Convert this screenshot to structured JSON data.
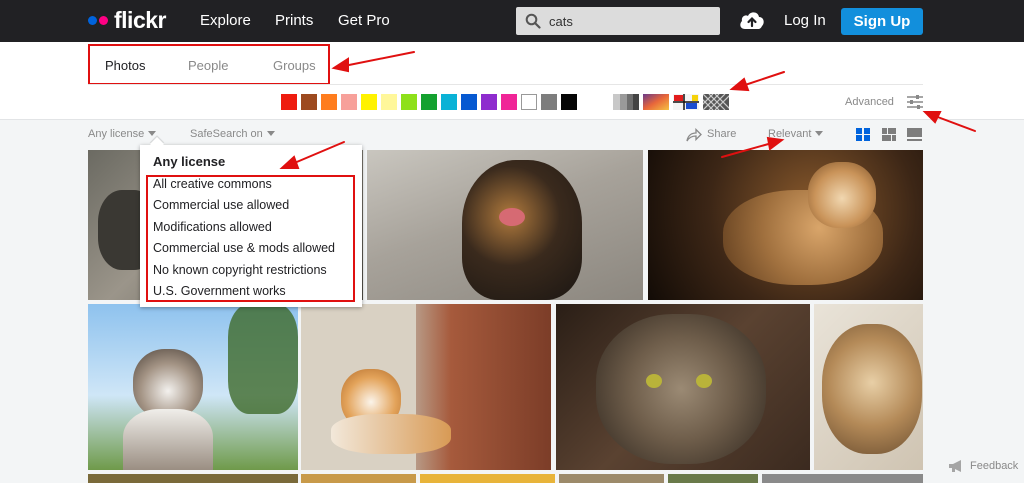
{
  "header": {
    "logo_text": "flickr",
    "nav": [
      "Explore",
      "Prints",
      "Get Pro"
    ],
    "search_value": "cats",
    "login_label": "Log In",
    "signup_label": "Sign Up"
  },
  "tabs": [
    "Photos",
    "People",
    "Groups"
  ],
  "active_tab": "Photos",
  "color_filters": [
    "#ee1c0f",
    "#9d4a1f",
    "#ff7d1e",
    "#f7a09a",
    "#fff200",
    "#fff79a",
    "#8ee01a",
    "#14a12f",
    "#0ab2d6",
    "#0659d1",
    "#8e2cce",
    "#f02597",
    "#ffffff",
    "#7d7d7d",
    "#050505"
  ],
  "advanced_label": "Advanced",
  "controls": {
    "license_label": "Any license",
    "safesearch_label": "SafeSearch on",
    "share_label": "Share",
    "sort_label": "Relevant"
  },
  "license_dropdown": {
    "title": "Any license",
    "options": [
      "All creative commons",
      "Commercial use allowed",
      "Modifications allowed",
      "Commercial use & mods allowed",
      "No known copyright restrictions",
      "U.S. Government works"
    ]
  },
  "feedback_label": "Feedback",
  "colors": {
    "accent_blue": "#128fdc",
    "annotation_red": "#e01010"
  }
}
